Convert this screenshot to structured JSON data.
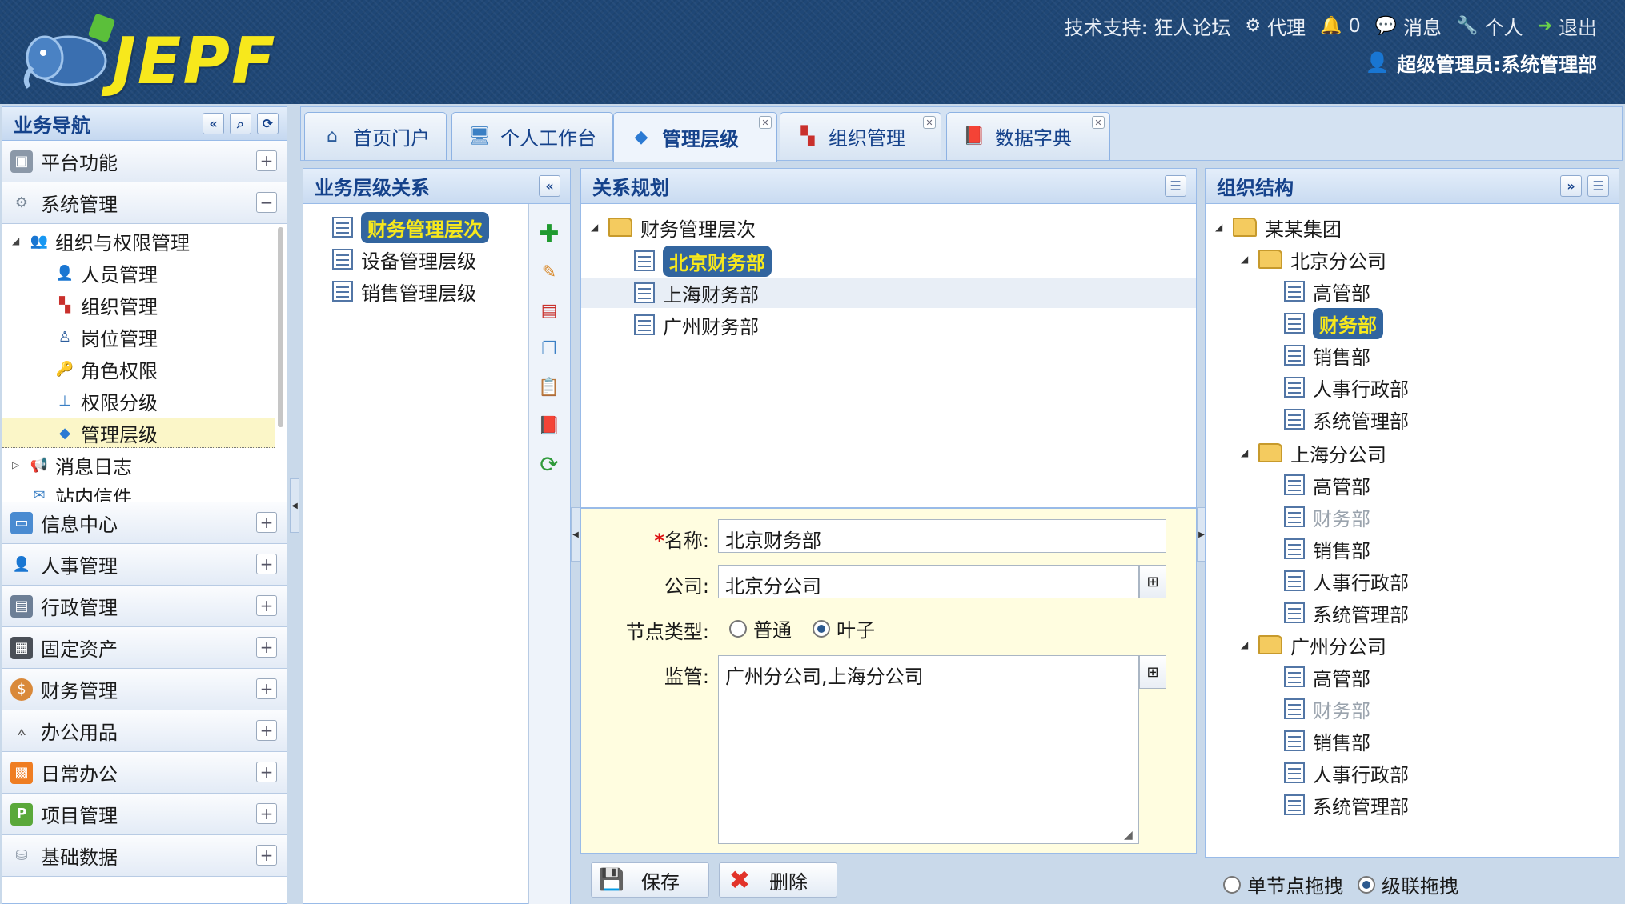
{
  "header": {
    "brand": "JEPF",
    "links": {
      "support": "技术支持: 狂人论坛",
      "agent": "代理",
      "bell_count": "0",
      "messages": "消息",
      "personal": "个人",
      "logout": "退出"
    },
    "user": "超级管理员:系统管理部"
  },
  "nav": {
    "title": "业务导航",
    "sections_top": [
      {
        "label": "平台功能",
        "toggle": "+"
      },
      {
        "label": "系统管理",
        "toggle": "−"
      }
    ],
    "tree": [
      {
        "label": "组织与权限管理"
      },
      {
        "label": "人员管理"
      },
      {
        "label": "组织管理"
      },
      {
        "label": "岗位管理"
      },
      {
        "label": "角色权限"
      },
      {
        "label": "权限分级"
      },
      {
        "label": "管理层级"
      },
      {
        "label": "消息日志"
      },
      {
        "label": "站内信件"
      }
    ],
    "sections_bottom": [
      {
        "label": "信息中心",
        "toggle": "+"
      },
      {
        "label": "人事管理",
        "toggle": "+"
      },
      {
        "label": "行政管理",
        "toggle": "+"
      },
      {
        "label": "固定资产",
        "toggle": "+"
      },
      {
        "label": "财务管理",
        "toggle": "+"
      },
      {
        "label": "办公用品",
        "toggle": "+"
      },
      {
        "label": "日常办公",
        "toggle": "+"
      },
      {
        "label": "项目管理",
        "toggle": "+"
      },
      {
        "label": "基础数据",
        "toggle": "+"
      }
    ]
  },
  "tabs": [
    {
      "label": "首页门户"
    },
    {
      "label": "个人工作台"
    },
    {
      "label": "管理层级"
    },
    {
      "label": "组织管理"
    },
    {
      "label": "数据字典"
    }
  ],
  "hierarchy": {
    "title": "业务层级关系",
    "items": [
      {
        "label": "财务管理层次"
      },
      {
        "label": "设备管理层级"
      },
      {
        "label": "销售管理层级"
      }
    ]
  },
  "plan": {
    "title": "关系规划",
    "root": "财务管理层次",
    "children": [
      "北京财务部",
      "上海财务部",
      "广州财务部"
    ]
  },
  "form": {
    "name_label": "名称:",
    "name_value": "北京财务部",
    "company_label": "公司:",
    "company_value": "北京分公司",
    "type_label": "节点类型:",
    "type_options": [
      "普通",
      "叶子"
    ],
    "type_selected": "叶子",
    "supervise_label": "监管:",
    "supervise_value": "广州分公司,上海分公司"
  },
  "actions": {
    "save": "保存",
    "delete": "删除"
  },
  "org": {
    "title": "组织结构",
    "root": "某某集团",
    "branches": [
      {
        "label": "北京分公司",
        "depts": [
          "高管部",
          "财务部",
          "销售部",
          "人事行政部",
          "系统管理部"
        ]
      },
      {
        "label": "上海分公司",
        "depts": [
          "高管部",
          "财务部",
          "销售部",
          "人事行政部",
          "系统管理部"
        ]
      },
      {
        "label": "广州分公司",
        "depts": [
          "高管部",
          "财务部",
          "销售部",
          "人事行政部",
          "系统管理部"
        ]
      }
    ],
    "drag_options": [
      "单节点拖拽",
      "级联拖拽"
    ],
    "drag_selected": "级联拖拽"
  },
  "colors": {
    "header_bg": "#1f4776",
    "brand_yellow": "#f7e81c",
    "panel_title": "#15428b",
    "highlight_bg": "#32659f"
  }
}
